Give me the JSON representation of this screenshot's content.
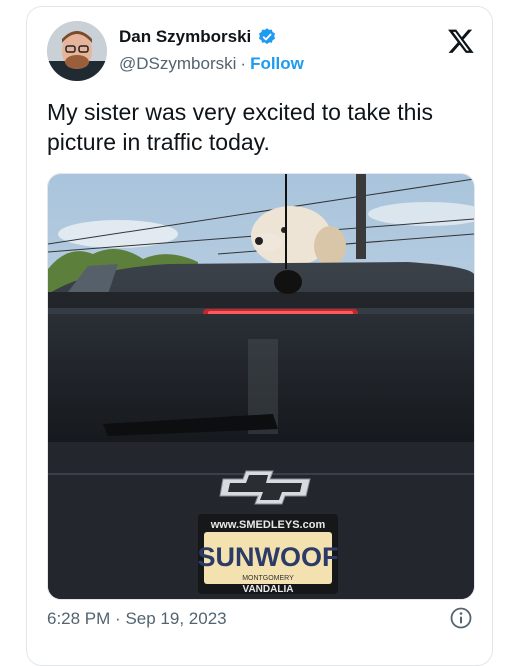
{
  "author": {
    "name": "Dan Szymborski",
    "handle": "@DSzymborski",
    "separator": "·",
    "follow_label": "Follow",
    "verified_color": "#1d9bf0"
  },
  "tweet": {
    "text": "My sister was very excited to take this picture in traffic today."
  },
  "media": {
    "plate_top": "www.SMEDLEYS.com",
    "plate_main": "SUNWOOF",
    "plate_county": "MONTGOMERY",
    "plate_bottom": "VANDALIA"
  },
  "footer": {
    "time": "6:28 PM",
    "separator": "·",
    "date": "Sep 19, 2023"
  },
  "icons": {
    "logo": "x-logo-icon",
    "info": "info-icon",
    "verified": "verified-badge-icon"
  }
}
